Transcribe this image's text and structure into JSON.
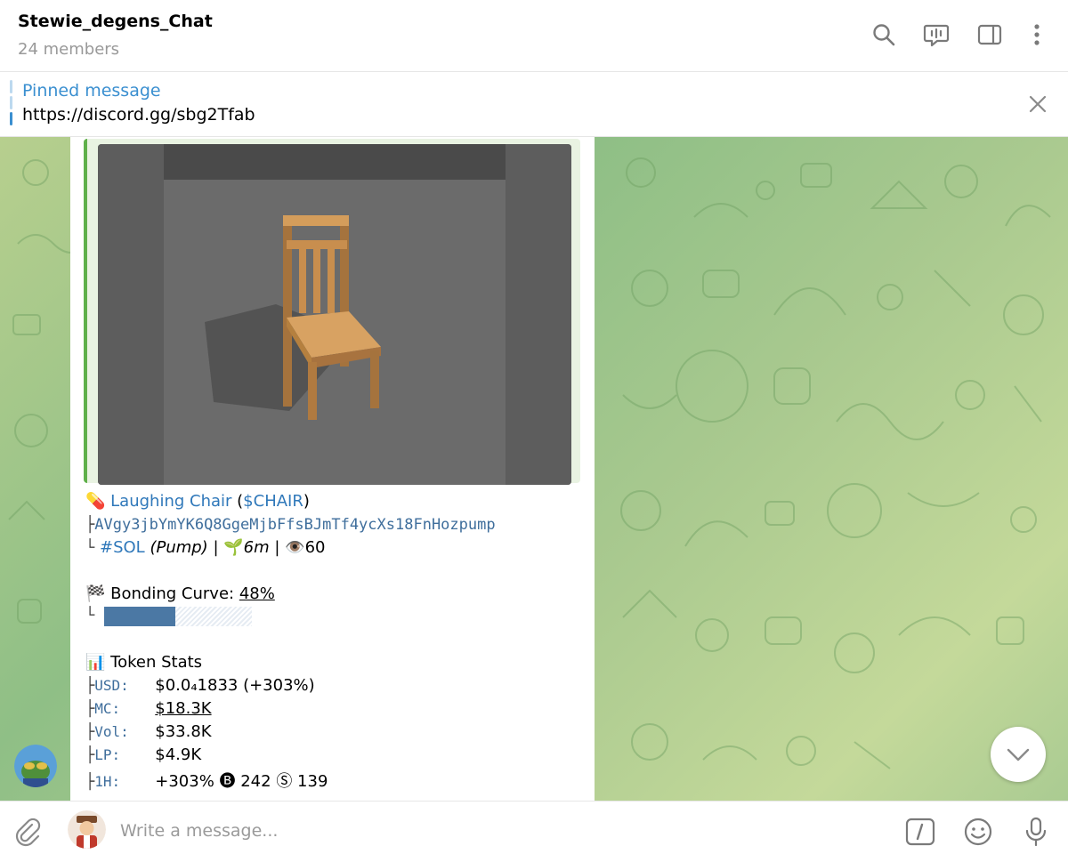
{
  "header": {
    "title": "Stewie_degens_Chat",
    "subtitle": "24 members",
    "icons": [
      "search-icon",
      "live-chat-icon",
      "sidebar-toggle-icon",
      "more-vertical-icon"
    ]
  },
  "pinned": {
    "label": "Pinned message",
    "text": "https://discord.gg/sbg2Tfab"
  },
  "message": {
    "pill_emoji": "💊",
    "token_name": "Laughing Chair",
    "ticker_open": " (",
    "ticker": "$CHAIR",
    "ticker_close": ")",
    "tree_mid": "├",
    "tree_end": "└",
    "address": "AVgy3jbYmYK6Q8GgeMjbFfsBJmTf4ycXs18FnHozpump",
    "chain_tag": "#SOL",
    "platform": "(Pump)",
    "sep": " | ",
    "age_emoji": "🌱",
    "age": "6m",
    "views_emoji": "👁️",
    "views": "60",
    "bonding": {
      "emoji": "🏁",
      "label": "Bonding Curve: ",
      "value": "48%",
      "progress": 0.48
    },
    "stats": {
      "emoji": "📊",
      "title": "Token Stats",
      "rows": [
        {
          "label": "USD:",
          "value": "$0.0₄1833 (+303%)"
        },
        {
          "label": "MC:",
          "value": "$18.3K"
        },
        {
          "label": "Vol:",
          "value": "$33.8K"
        },
        {
          "label": "LP:",
          "value": "$4.9K"
        },
        {
          "label": "1H:",
          "value": "+303% 🅑 242 Ⓢ 139"
        }
      ]
    }
  },
  "composer": {
    "placeholder": "Write a message..."
  },
  "colors": {
    "accent": "#3a8fd0",
    "link": "#2f78ba",
    "mono": "#3f6e9c",
    "progress": "#4b78a4",
    "media_border": "#5fb04a"
  }
}
